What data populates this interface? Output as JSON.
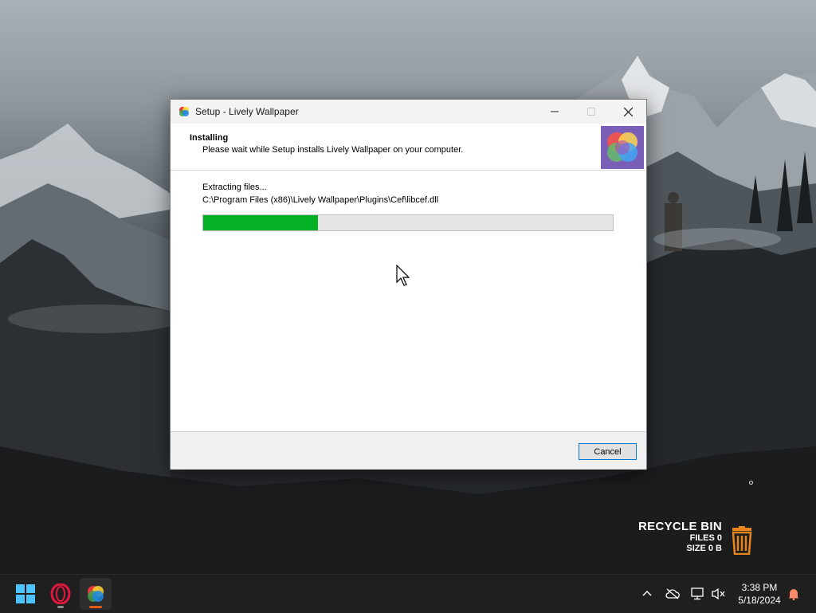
{
  "window": {
    "title": "Setup - Lively Wallpaper",
    "header_title": "Installing",
    "header_subtitle": "Please wait while Setup installs Lively Wallpaper on your computer.",
    "status_text": "Extracting files...",
    "current_file": "C:\\Program Files (x86)\\Lively Wallpaper\\Plugins\\Cef\\libcef.dll",
    "progress_fraction": 0.28,
    "cancel_label": "Cancel"
  },
  "recycle_bin": {
    "title": "RECYCLE BIN",
    "files": "FILES 0",
    "size": "SIZE 0 B"
  },
  "taskbar": {
    "apps": [
      "windows-start",
      "opera-browser",
      "lively-wallpaper"
    ],
    "time": "3:38 PM",
    "date": "5/18/2024"
  },
  "colors": {
    "progress": "#06b025",
    "accent": "#0078d4",
    "recycle_icon": "#e8841c",
    "notification_bell": "#ff8a65"
  }
}
